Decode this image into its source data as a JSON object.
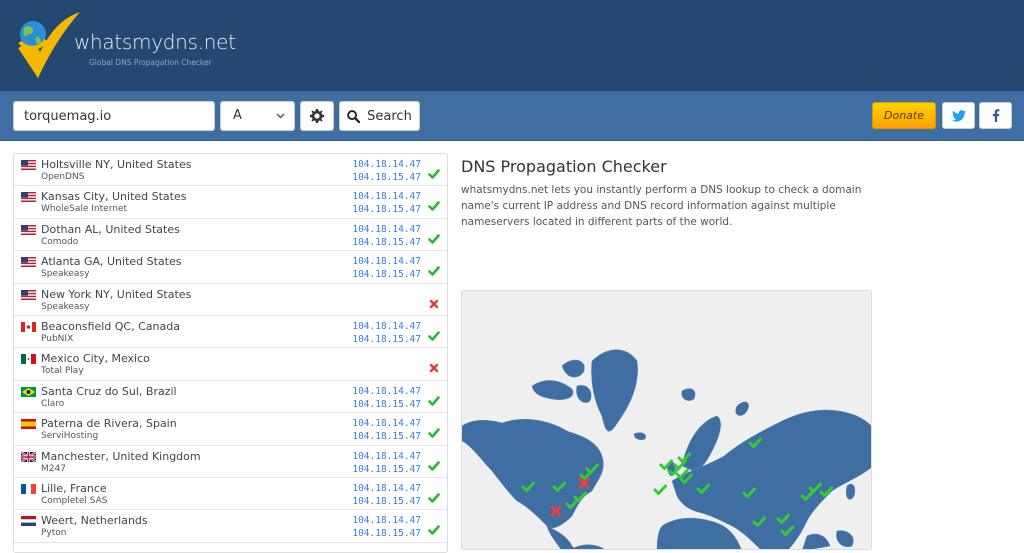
{
  "header": {
    "logo_text": "whatsmydns.net",
    "logo_tagline": "Global DNS Propagation Checker"
  },
  "toolbar": {
    "domain_value": "torquemag.io",
    "record_type": "A",
    "settings_icon": "gear-icon",
    "search_label": "Search",
    "search_icon": "search-icon",
    "donate_label": "Donate",
    "twitter_icon": "twitter-icon",
    "facebook_icon": "facebook-icon"
  },
  "colors": {
    "header_bg": "#24486f",
    "navbar_bg": "#3f6fa2",
    "ip_text": "#3b7ddd",
    "success": "#2eb82e",
    "failure": "#e53935",
    "map_land": "#3f6fa2",
    "donate": "#ffb300"
  },
  "results": [
    {
      "location": "Holtsville NY, United States",
      "provider": "OpenDNS",
      "flag": "us",
      "ips": [
        "104.18.14.47",
        "104.18.15.47"
      ],
      "status": "ok"
    },
    {
      "location": "Kansas City, United States",
      "provider": "WholeSale Internet",
      "flag": "us",
      "ips": [
        "104.18.14.47",
        "104.18.15.47"
      ],
      "status": "ok"
    },
    {
      "location": "Dothan AL, United States",
      "provider": "Comodo",
      "flag": "us",
      "ips": [
        "104.18.14.47",
        "104.18.15.47"
      ],
      "status": "ok"
    },
    {
      "location": "Atlanta GA, United States",
      "provider": "Speakeasy",
      "flag": "us",
      "ips": [
        "104.18.14.47",
        "104.18.15.47"
      ],
      "status": "ok"
    },
    {
      "location": "New York NY, United States",
      "provider": "Speakeasy",
      "flag": "us",
      "ips": [],
      "status": "fail"
    },
    {
      "location": "Beaconsfield QC, Canada",
      "provider": "PubNIX",
      "flag": "ca",
      "ips": [
        "104.18.14.47",
        "104.18.15.47"
      ],
      "status": "ok"
    },
    {
      "location": "Mexico City, Mexico",
      "provider": "Total Play",
      "flag": "mx",
      "ips": [],
      "status": "fail"
    },
    {
      "location": "Santa Cruz do Sul, Brazil",
      "provider": "Claro",
      "flag": "br",
      "ips": [
        "104.18.14.47",
        "104.18.15.47"
      ],
      "status": "ok"
    },
    {
      "location": "Paterna de Rivera, Spain",
      "provider": "ServiHosting",
      "flag": "es",
      "ips": [
        "104.18.14.47",
        "104.18.15.47"
      ],
      "status": "ok"
    },
    {
      "location": "Manchester, United Kingdom",
      "provider": "M247",
      "flag": "gb",
      "ips": [
        "104.18.14.47",
        "104.18.15.47"
      ],
      "status": "ok"
    },
    {
      "location": "Lille, France",
      "provider": "Completel SAS",
      "flag": "fr",
      "ips": [
        "104.18.14.47",
        "104.18.15.47"
      ],
      "status": "ok"
    },
    {
      "location": "Weert, Netherlands",
      "provider": "Pyton",
      "flag": "nl",
      "ips": [
        "104.18.14.47",
        "104.18.15.47"
      ],
      "status": "ok"
    }
  ],
  "info": {
    "title": "DNS Propagation Checker",
    "description": "whatsmydns.net lets you instantly perform a DNS lookup to check a domain name's current IP address and DNS record information against multiple nameservers located in different parts of the world."
  },
  "map": {
    "markers": [
      {
        "name": "west-us",
        "status": "ok"
      },
      {
        "name": "kansas-city",
        "status": "ok"
      },
      {
        "name": "dothan",
        "status": "ok"
      },
      {
        "name": "atlanta",
        "status": "ok"
      },
      {
        "name": "holtsville",
        "status": "ok"
      },
      {
        "name": "beaconsfield",
        "status": "ok"
      },
      {
        "name": "new-york",
        "status": "fail"
      },
      {
        "name": "mexico-city",
        "status": "fail"
      },
      {
        "name": "spain",
        "status": "ok"
      },
      {
        "name": "uk",
        "status": "ok"
      },
      {
        "name": "france",
        "status": "ok"
      },
      {
        "name": "netherlands",
        "status": "ok"
      },
      {
        "name": "germany",
        "status": "ok"
      },
      {
        "name": "switzerland",
        "status": "ok"
      },
      {
        "name": "italy",
        "status": "ok"
      },
      {
        "name": "turkey",
        "status": "ok"
      },
      {
        "name": "russia",
        "status": "ok"
      },
      {
        "name": "pakistan",
        "status": "ok"
      },
      {
        "name": "india",
        "status": "ok"
      },
      {
        "name": "china",
        "status": "ok"
      },
      {
        "name": "korea",
        "status": "ok"
      },
      {
        "name": "japan",
        "status": "ok"
      },
      {
        "name": "vietnam",
        "status": "ok"
      },
      {
        "name": "malaysia",
        "status": "ok"
      }
    ]
  }
}
